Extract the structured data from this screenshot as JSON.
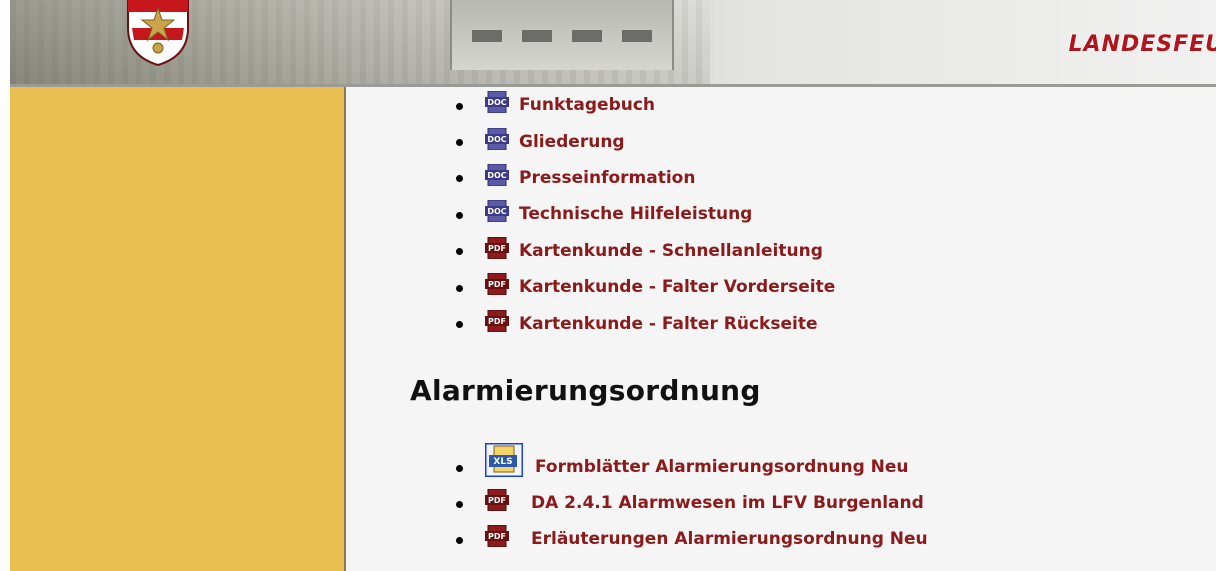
{
  "header": {
    "title": "LANDESFEU",
    "logo": "crest-icon",
    "brand_color": "#b3141b"
  },
  "colors": {
    "sidebar": "#e9bf52",
    "content_bg": "#f5f5f5",
    "link": "#8b1a1a"
  },
  "documents": [
    {
      "icon": "doc-file-icon",
      "type_label": "DOC",
      "label": "Funktagebuch"
    },
    {
      "icon": "doc-file-icon",
      "type_label": "DOC",
      "label": "Gliederung"
    },
    {
      "icon": "doc-file-icon",
      "type_label": "DOC",
      "label": "Presseinformation"
    },
    {
      "icon": "doc-file-icon",
      "type_label": "DOC",
      "label": "Technische Hilfeleistung"
    },
    {
      "icon": "pdf-file-icon",
      "type_label": "PDF",
      "label": "Kartenkunde - Schnellanleitung"
    },
    {
      "icon": "pdf-file-icon",
      "type_label": "PDF",
      "label": "Kartenkunde - Falter Vorderseite"
    },
    {
      "icon": "pdf-file-icon",
      "type_label": "PDF",
      "label": "Kartenkunde - Falter Rückseite"
    }
  ],
  "section": {
    "title": "Alarmierungsordnung"
  },
  "alarm_documents": [
    {
      "icon": "xls-file-icon",
      "type_label": "XLS",
      "label": "Formblätter Alarmierungsordnung Neu"
    },
    {
      "icon": "pdf-file-icon",
      "type_label": "PDF",
      "label": "DA 2.4.1 Alarmwesen im LFV Burgenland"
    },
    {
      "icon": "pdf-file-icon",
      "type_label": "PDF",
      "label": "Erläuterungen Alarmierungsordnung Neu"
    }
  ]
}
